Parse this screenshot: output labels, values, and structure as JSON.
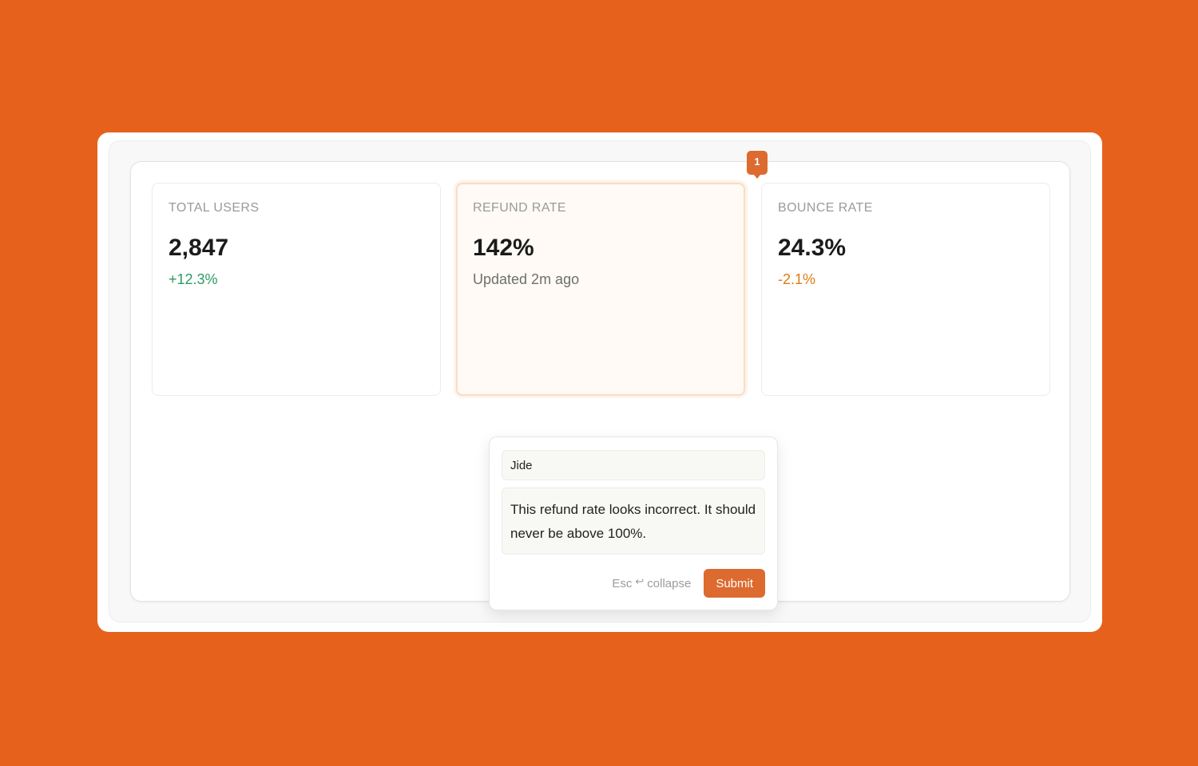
{
  "cards": [
    {
      "label": "TOTAL USERS",
      "value": "2,847",
      "sub": "+12.3%"
    },
    {
      "label": "REFUND RATE",
      "value": "142%",
      "sub": "Updated 2m ago"
    },
    {
      "label": "BOUNCE RATE",
      "value": "24.3%",
      "sub": "-2.1%"
    }
  ],
  "marker": {
    "number": "1"
  },
  "comment": {
    "author": "Jide",
    "text": "This refund rate looks incorrect. It should never be above 100%.",
    "hint_key": "Esc",
    "hint_icon": "return-icon",
    "hint_action": "collapse",
    "submit_label": "Submit"
  },
  "colors": {
    "background": "#E6621C",
    "accent": "#DD6A2F",
    "positive": "#2E9A62",
    "negative": "#E07A12"
  }
}
